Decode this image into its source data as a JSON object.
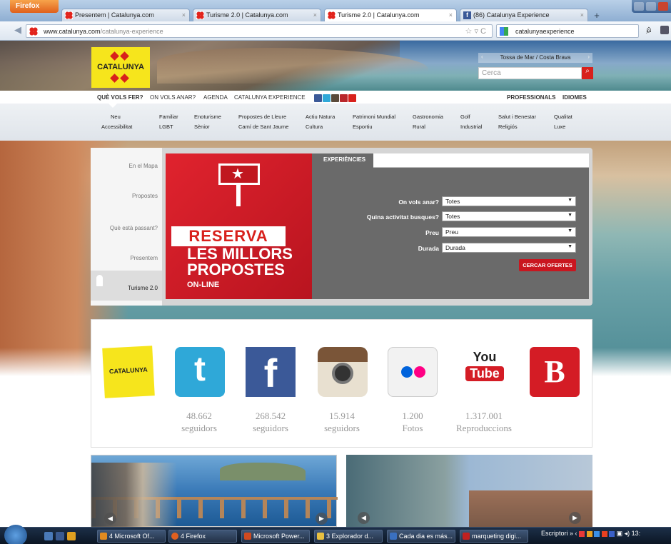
{
  "browser": {
    "app_button": "Firefox",
    "tabs": [
      {
        "title": "Presentem | Catalunya.com"
      },
      {
        "title": "Turisme 2.0 | Catalunya.com"
      },
      {
        "title": "Turisme 2.0 | Catalunya.com"
      },
      {
        "title": "(86) Catalunya Experience"
      }
    ],
    "url_domain": "www.catalunya.com",
    "url_path": "/catalunya-experience",
    "search_query": "catalunyaexperience",
    "fb_icon_letter": "f"
  },
  "site": {
    "logo_text": "CATALUNYA",
    "destination": "Tossa de Mar / Costa Brava",
    "search_placeholder": "Cerca",
    "main_nav": [
      "QUÈ VOLS FER?",
      "ON VOLS ANAR?",
      "AGENDA",
      "CATALUNYA EXPERIENCE"
    ],
    "right_nav": [
      "PROFESSIONALS",
      "IDIOMES"
    ],
    "sub_nav_row1": [
      "Neu",
      "Familiar",
      "Enoturisme",
      "Propostes de Lleure",
      "Actiu Natura",
      "Patrimoni Mundial",
      "Gastronomia",
      "Golf",
      "Salut i Benestar",
      "Qualitat"
    ],
    "sub_nav_row2": [
      "Accessibilitat",
      "LGBT",
      "Sènior",
      "Camí de Sant Jaume",
      "Cultura",
      "Esportiu",
      "Rural",
      "Industrial",
      "Religiós",
      "Luxe"
    ],
    "social_icon_colors": [
      "#3b5998",
      "#2fa8d8",
      "#5a4a3a",
      "#b9272b",
      "#d8211c"
    ]
  },
  "widget": {
    "side_items": [
      "En el Mapa",
      "Propostes",
      "Què està passant?",
      "Presentem",
      "Turisme 2.0"
    ],
    "promo": {
      "line1": "RESERVA",
      "line2": "LES MILLORS",
      "line3": "PROPOSTES",
      "line4": "ON-LINE"
    },
    "tab": "EXPERIÈNCIES",
    "fields": [
      {
        "label": "On vols anar?",
        "value": "Totes"
      },
      {
        "label": "Quina activitat busques?",
        "value": "Totes"
      },
      {
        "label": "Preu",
        "value": "Preu"
      },
      {
        "label": "Durada",
        "value": "Durada"
      }
    ],
    "button": "CERCAR OFERTES"
  },
  "social": {
    "items": [
      {
        "name": "Catalunya",
        "count": "",
        "unit": ""
      },
      {
        "name": "Twitter",
        "glyph": "t",
        "count": "48.662",
        "unit": "seguidors"
      },
      {
        "name": "Facebook",
        "glyph": "f",
        "count": "268.542",
        "unit": "seguidors"
      },
      {
        "name": "Instagram",
        "count": "15.914",
        "unit": "seguidors"
      },
      {
        "name": "Flickr",
        "count": "1.200",
        "unit": "Fotos"
      },
      {
        "name": "YouTube",
        "glyph_top": "You",
        "glyph_bottom": "Tube",
        "count": "1.317.001",
        "unit": "Reproduccions"
      },
      {
        "name": "Blogger",
        "glyph": "B",
        "count": "",
        "unit": ""
      }
    ]
  },
  "taskbar": {
    "items": [
      "4 Microsoft Of...",
      "4 Firefox",
      "Microsoft Power...",
      "3 Explorador d...",
      "Cada dia es más...",
      "marqueting digi..."
    ],
    "tray_label": "Escriptori",
    "clock": "13:"
  }
}
